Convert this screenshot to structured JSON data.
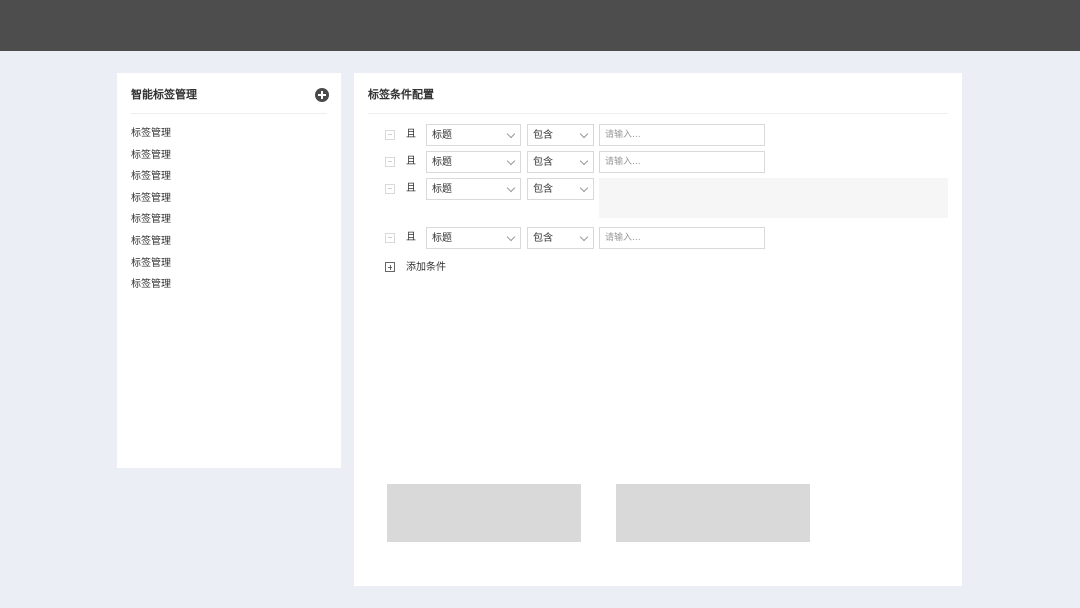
{
  "sidebar": {
    "title": "智能标签管理",
    "add_icon": "plus-circle-icon",
    "items": [
      {
        "label": "标签管理"
      },
      {
        "label": "标签管理"
      },
      {
        "label": "标签管理"
      },
      {
        "label": "标签管理"
      },
      {
        "label": "标签管理"
      },
      {
        "label": "标签管理"
      },
      {
        "label": "标签管理"
      },
      {
        "label": "标签管理"
      }
    ]
  },
  "config": {
    "title": "标签条件配置",
    "conditions": [
      {
        "logic": "且",
        "field": "标题",
        "operator": "包含",
        "placeholder": "请输入...",
        "input_type": "text"
      },
      {
        "logic": "且",
        "field": "标题",
        "operator": "包含",
        "placeholder": "请输入...",
        "input_type": "text"
      },
      {
        "logic": "且",
        "field": "标题",
        "operator": "包含",
        "placeholder": "",
        "input_type": "textarea"
      },
      {
        "logic": "且",
        "field": "标题",
        "operator": "包含",
        "placeholder": "请输入...",
        "input_type": "text"
      }
    ],
    "add_condition_label": "添加条件",
    "add_condition_icon": "plus-square-icon"
  },
  "colors": {
    "topbar": "#4d4d4d",
    "background": "#eceef5",
    "panel": "#ffffff",
    "placeholder_block": "#d9d9d9"
  }
}
